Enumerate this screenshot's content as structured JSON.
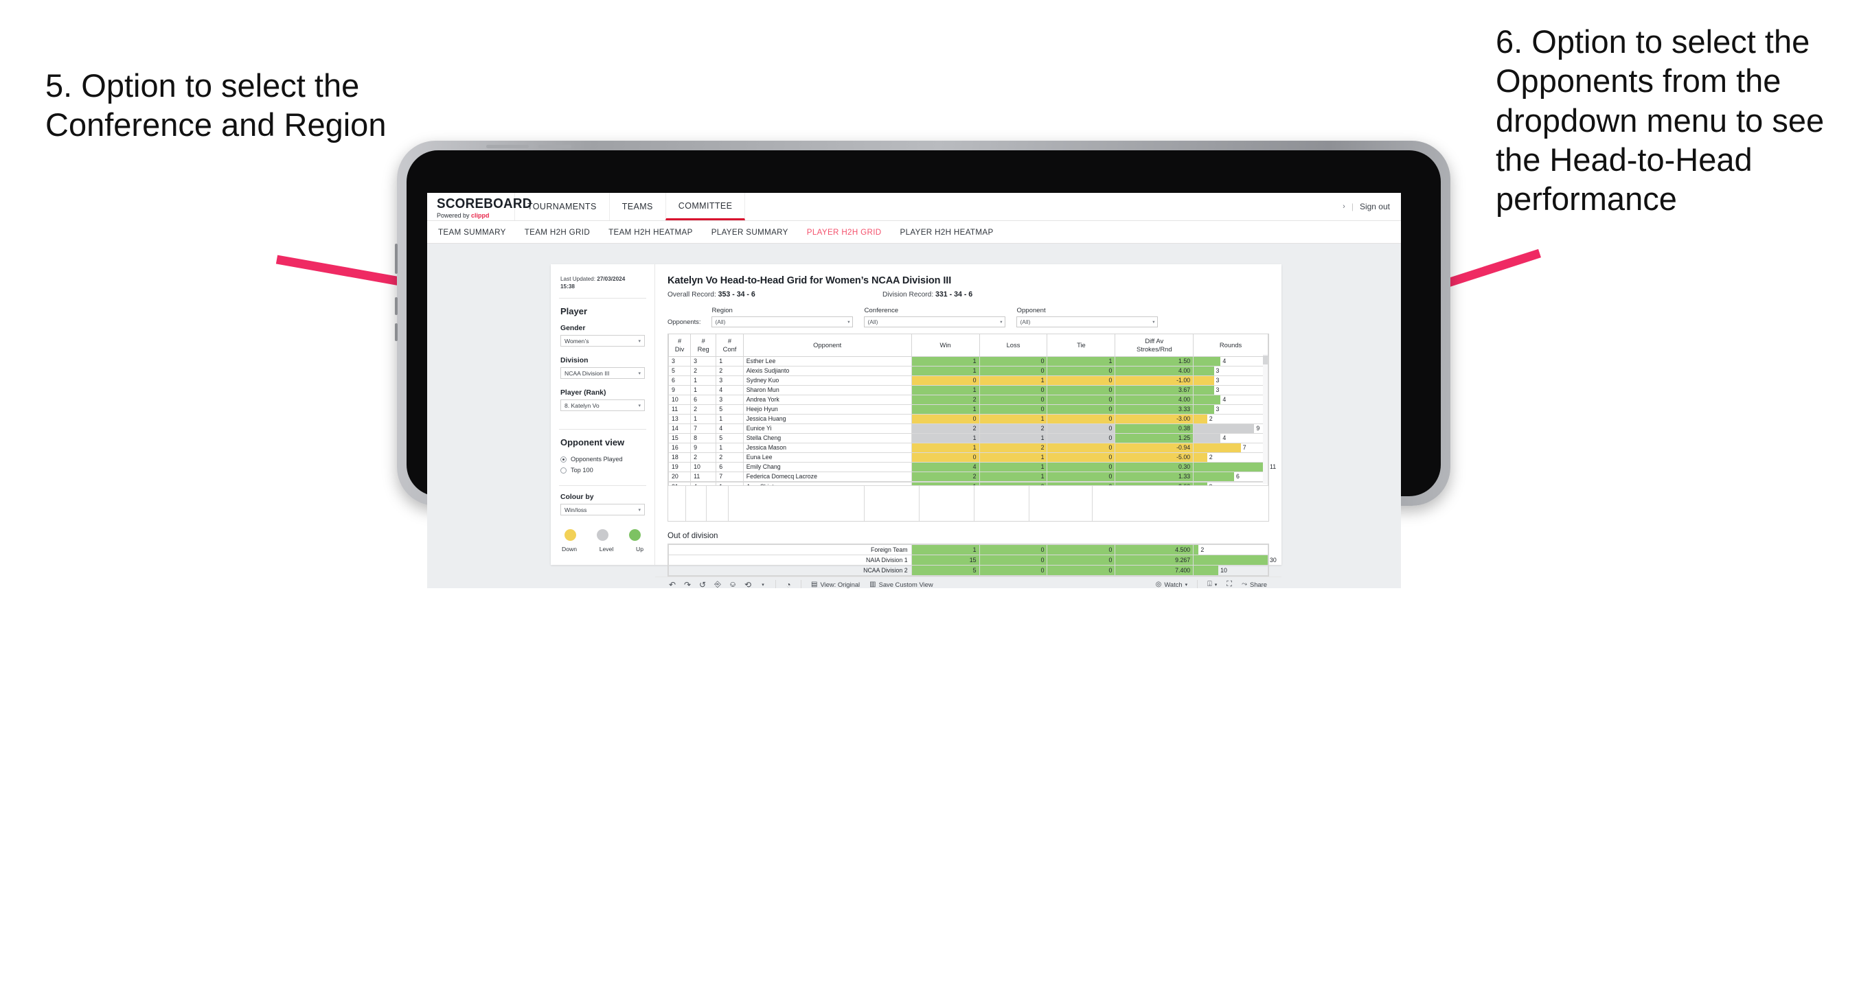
{
  "annotations": {
    "left": "5. Option to select the Conference and Region",
    "right": "6. Option to select the Opponents from the dropdown menu to see the Head-to-Head performance",
    "arrow_color": "#ef2a63"
  },
  "topnav": {
    "brand_title": "SCOREBOARD",
    "brand_sub_prefix": "Powered by ",
    "brand_sub_name": "clippd",
    "items": [
      {
        "label": "TOURNAMENTS",
        "active": false
      },
      {
        "label": "TEAMS",
        "active": false
      },
      {
        "label": "COMMITTEE",
        "active": true
      }
    ],
    "chevron": "›",
    "separator": "|",
    "signout": "Sign out"
  },
  "subnav": {
    "items": [
      {
        "label": "TEAM SUMMARY",
        "active": false
      },
      {
        "label": "TEAM H2H GRID",
        "active": false
      },
      {
        "label": "TEAM H2H HEATMAP",
        "active": false
      },
      {
        "label": "PLAYER SUMMARY",
        "active": false
      },
      {
        "label": "PLAYER H2H GRID",
        "active": true
      },
      {
        "label": "PLAYER H2H HEATMAP",
        "active": false
      }
    ]
  },
  "sidebar": {
    "last_updated_label": "Last Updated:",
    "last_updated_value": "27/03/2024",
    "last_updated_time": "15:38",
    "section_player": "Player",
    "gender_label": "Gender",
    "gender_value": "Women’s",
    "division_label": "Division",
    "division_value": "NCAA Division III",
    "player_label": "Player (Rank)",
    "player_value": "8. Katelyn Vo",
    "opponent_view_label": "Opponent view",
    "opponent_view_options": [
      {
        "label": "Opponents Played",
        "selected": true
      },
      {
        "label": "Top 100",
        "selected": false
      }
    ],
    "colour_by_label": "Colour by",
    "colour_by_value": "Win/loss",
    "legend": [
      {
        "label": "Down",
        "color": "#f2d157"
      },
      {
        "label": "Level",
        "color": "#c9cacd"
      },
      {
        "label": "Up",
        "color": "#7dc263"
      }
    ],
    "caret": "▾"
  },
  "main": {
    "title": "Katelyn Vo Head-to-Head Grid for Women’s NCAA Division III",
    "overall_label": "Overall Record: ",
    "overall_value": "353 - 34 - 6",
    "division_label": "Division Record: ",
    "division_value": "331 - 34 - 6",
    "opponents_label": "Opponents:",
    "filters": [
      {
        "label": "Region",
        "value": "(All)"
      },
      {
        "label": "Conference",
        "value": "(All)"
      },
      {
        "label": "Opponent",
        "value": "(All)"
      }
    ],
    "caret": "▾"
  },
  "chart_data": {
    "type": "table",
    "title": "Katelyn Vo Head-to-Head Grid for Women’s NCAA Division III",
    "columns": [
      "# Div",
      "# Reg",
      "# Conf",
      "Opponent",
      "Win",
      "Loss",
      "Tie",
      "Diff Av Strokes/Rnd",
      "Rounds"
    ],
    "header_lines": [
      [
        "#",
        "Div"
      ],
      [
        "#",
        "Reg"
      ],
      [
        "#",
        "Conf"
      ],
      [
        "Opponent"
      ],
      [
        "Win"
      ],
      [
        "Loss"
      ],
      [
        "Tie"
      ],
      [
        "Diff Av",
        "Strokes/Rnd"
      ],
      [
        "Rounds"
      ]
    ],
    "rounds_max": 11,
    "rows": [
      {
        "div": "3",
        "reg": "3",
        "conf": "1",
        "opponent": "Esther Lee",
        "win": "1",
        "loss": "0",
        "tie": "1",
        "diff": "1.50",
        "rounds": 4,
        "state": "up"
      },
      {
        "div": "5",
        "reg": "2",
        "conf": "2",
        "opponent": "Alexis Sudjianto",
        "win": "1",
        "loss": "0",
        "tie": "0",
        "diff": "4.00",
        "rounds": 3,
        "state": "up"
      },
      {
        "div": "6",
        "reg": "1",
        "conf": "3",
        "opponent": "Sydney Kuo",
        "win": "0",
        "loss": "1",
        "tie": "0",
        "diff": "-1.00",
        "rounds": 3,
        "state": "down"
      },
      {
        "div": "9",
        "reg": "1",
        "conf": "4",
        "opponent": "Sharon Mun",
        "win": "1",
        "loss": "0",
        "tie": "0",
        "diff": "3.67",
        "rounds": 3,
        "state": "up"
      },
      {
        "div": "10",
        "reg": "6",
        "conf": "3",
        "opponent": "Andrea York",
        "win": "2",
        "loss": "0",
        "tie": "0",
        "diff": "4.00",
        "rounds": 4,
        "state": "up"
      },
      {
        "div": "11",
        "reg": "2",
        "conf": "5",
        "opponent": "Heejo Hyun",
        "win": "1",
        "loss": "0",
        "tie": "0",
        "diff": "3.33",
        "rounds": 3,
        "state": "up"
      },
      {
        "div": "13",
        "reg": "1",
        "conf": "1",
        "opponent": "Jessica Huang",
        "win": "0",
        "loss": "1",
        "tie": "0",
        "diff": "-3.00",
        "rounds": 2,
        "state": "down"
      },
      {
        "div": "14",
        "reg": "7",
        "conf": "4",
        "opponent": "Eunice Yi",
        "win": "2",
        "loss": "2",
        "tie": "0",
        "diff": "0.38",
        "rounds": 9,
        "state": "level",
        "diff_state": "up"
      },
      {
        "div": "15",
        "reg": "8",
        "conf": "5",
        "opponent": "Stella Cheng",
        "win": "1",
        "loss": "1",
        "tie": "0",
        "diff": "1.25",
        "rounds": 4,
        "state": "level",
        "diff_state": "up"
      },
      {
        "div": "16",
        "reg": "9",
        "conf": "1",
        "opponent": "Jessica Mason",
        "win": "1",
        "loss": "2",
        "tie": "0",
        "diff": "-0.94",
        "rounds": 7,
        "state": "down"
      },
      {
        "div": "18",
        "reg": "2",
        "conf": "2",
        "opponent": "Euna Lee",
        "win": "0",
        "loss": "1",
        "tie": "0",
        "diff": "-5.00",
        "rounds": 2,
        "state": "down"
      },
      {
        "div": "19",
        "reg": "10",
        "conf": "6",
        "opponent": "Emily Chang",
        "win": "4",
        "loss": "1",
        "tie": "0",
        "diff": "0.30",
        "rounds": 11,
        "state": "up"
      },
      {
        "div": "20",
        "reg": "11",
        "conf": "7",
        "opponent": "Federica Domecq Lacroze",
        "win": "2",
        "loss": "1",
        "tie": "0",
        "diff": "1.33",
        "rounds": 6,
        "state": "up"
      }
    ]
  },
  "out_of_division": {
    "title": "Out of division",
    "rounds_max": 30,
    "rows": [
      {
        "name": "Foreign Team",
        "win": "1",
        "loss": "0",
        "tie": "0",
        "diff": "4.500",
        "rounds": 2,
        "state": "up"
      },
      {
        "name": "NAIA Division 1",
        "win": "15",
        "loss": "0",
        "tie": "0",
        "diff": "9.267",
        "rounds": 30,
        "state": "up"
      },
      {
        "name": "NCAA Division 2",
        "win": "5",
        "loss": "0",
        "tie": "0",
        "diff": "7.400",
        "rounds": 10,
        "state": "up"
      }
    ]
  },
  "toolbar": {
    "icons": [
      "undo-icon",
      "redo-icon",
      "revert-icon",
      "refresh-icon",
      "pause-icon",
      "loop-icon",
      "loop-caret-icon"
    ],
    "glyphs": [
      "↶",
      "↷",
      "↺",
      "↻",
      "⏸",
      "⟲",
      "▾"
    ],
    "clock_glyph": "◴",
    "view_label": "View: Original",
    "save_label": "Save Custom View",
    "watch_label": "Watch",
    "watch_caret": "▾",
    "download_caret": "▾",
    "share_label": "Share",
    "separator": "|"
  }
}
